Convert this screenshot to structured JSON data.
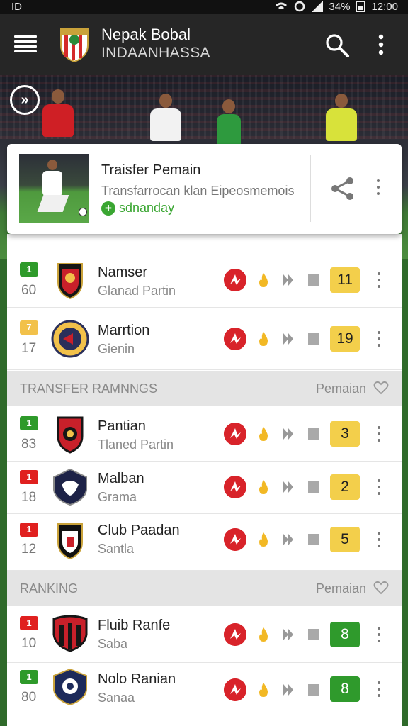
{
  "status_bar": {
    "left_glyph": "ID",
    "battery": "34%",
    "time": "12:00"
  },
  "app_bar": {
    "title": "Nepak Bobal",
    "subtitle": "INDAANHASSA"
  },
  "news": {
    "title": "Traisfer Pemain",
    "description": "Transfarrocan klan Eipeosmemois",
    "tag": "sdnanday"
  },
  "sections": [
    {
      "label": "TRANSFER RAMNNGS",
      "right": "Pemaian"
    },
    {
      "label": "RANKING",
      "right": "Pemaian"
    }
  ],
  "rows": [
    {
      "badge": "1",
      "badge_color": "#2e9a2a",
      "pos": "60",
      "name": "Namser",
      "sub": "Glanad Partin",
      "score": "11",
      "score_style": "yellow",
      "crest": "crest-red-black"
    },
    {
      "badge": "7",
      "badge_color": "#f2c14a",
      "pos": "17",
      "name": "Marrtion",
      "sub": "Gienin",
      "score": "19",
      "score_style": "yellow",
      "crest": "crest-gold-navy"
    },
    {
      "badge": "1",
      "badge_color": "#2e9a2a",
      "pos": "83",
      "name": "Pantian",
      "sub": "Tlaned Partin",
      "score": "3",
      "score_style": "yellow",
      "crest": "crest-red-black-shield"
    },
    {
      "badge": "1",
      "badge_color": "#e0201f",
      "pos": "18",
      "name": "Malban",
      "sub": "Grama",
      "score": "2",
      "score_style": "yellow",
      "crest": "crest-navy"
    },
    {
      "badge": "1",
      "badge_color": "#e0201f",
      "pos": "12",
      "name": "Club Paadan",
      "sub": "Santla",
      "score": "5",
      "score_style": "yellow",
      "crest": "crest-black-white"
    },
    {
      "badge": "1",
      "badge_color": "#e0201f",
      "pos": "10",
      "name": "Fluib Ranfe",
      "sub": "Saba",
      "score": "8",
      "score_style": "green",
      "crest": "crest-red-black"
    },
    {
      "badge": "1",
      "badge_color": "#2e9a2a",
      "pos": "80",
      "name": "Nolo Ranian",
      "sub": "Sanaa",
      "score": "8",
      "score_style": "green",
      "crest": "crest-navy-white"
    }
  ]
}
